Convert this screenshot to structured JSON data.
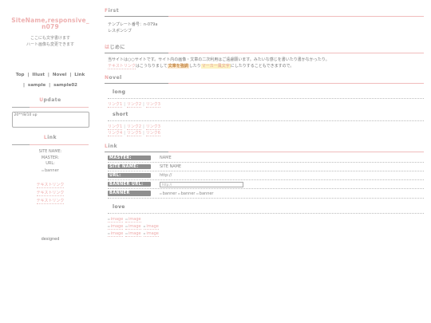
{
  "sidebar": {
    "site_name_line1": "SiteName,responsive_",
    "site_name_line2": "n079",
    "desc_line1": "ここにも文字書けます",
    "desc_line2": "ハート画像も変更できます",
    "nav_row1": [
      "Top",
      "Illust",
      "Novel",
      "Link"
    ],
    "nav_row2": [
      "sample",
      "sample02"
    ],
    "nav_sep": "|",
    "update": {
      "heading_first": "U",
      "heading_rest": "pdate",
      "text": "20**/8/10 up"
    },
    "link": {
      "heading_first": "L",
      "heading_rest": "ink",
      "site_name": "SITE NAME:",
      "master": "MASTER:",
      "url": "URL:",
      "banner": "banner"
    },
    "text_links": [
      "テキストリンク",
      "テキストリンク",
      "テキストリンク"
    ],
    "designed": "designed"
  },
  "main": {
    "first": {
      "heading_first": "F",
      "heading_rest": "irst",
      "template_no": "テンプレート番号：n-079a",
      "responsive": "レスポンシブ"
    },
    "hajimeni": {
      "heading_first": "は",
      "heading_rest": "じめに",
      "line1": "当サイトは○○サイトです。サイト内の画像・文章の二次利用はご遠慮願います。みたいな感じを書いたり書かなかったり。",
      "line2_link": "テキストリンク",
      "line2_a": "はこうなりまして",
      "line2_hl": "文章を強調",
      "line2_b": "したり",
      "line2_mk": "マーカー風文字",
      "line2_c": "にしたりすることもできますので。"
    },
    "novel": {
      "heading_first": "N",
      "heading_rest": "ovel",
      "long_title": "long",
      "long_links": [
        "リンク1",
        "リンク2",
        "リンク3"
      ],
      "short_title": "short",
      "short_row1": [
        "リンク1",
        "リンク2",
        "リンク3"
      ],
      "short_row2": [
        "リンク4",
        "リンク5",
        "リンク6"
      ],
      "sep": "|"
    },
    "link": {
      "heading_first": "L",
      "heading_rest": "ink",
      "master_label": "MASTER:",
      "master_value": "NAME",
      "site_label": "SITE NAME:",
      "site_value": "SITE NAME",
      "url_label": "URL:",
      "url_value": "http://",
      "banner_url_label": "BANNER URL:",
      "banner_url_value": "http://",
      "banner_label": "BANNER",
      "banners": [
        "banner",
        "banner",
        "banner"
      ],
      "love_title": "love",
      "images_row1": [
        "image",
        "image"
      ],
      "images_row2": [
        "image",
        "image",
        "image"
      ],
      "images_row3": [
        "image",
        "image",
        "image"
      ]
    }
  }
}
